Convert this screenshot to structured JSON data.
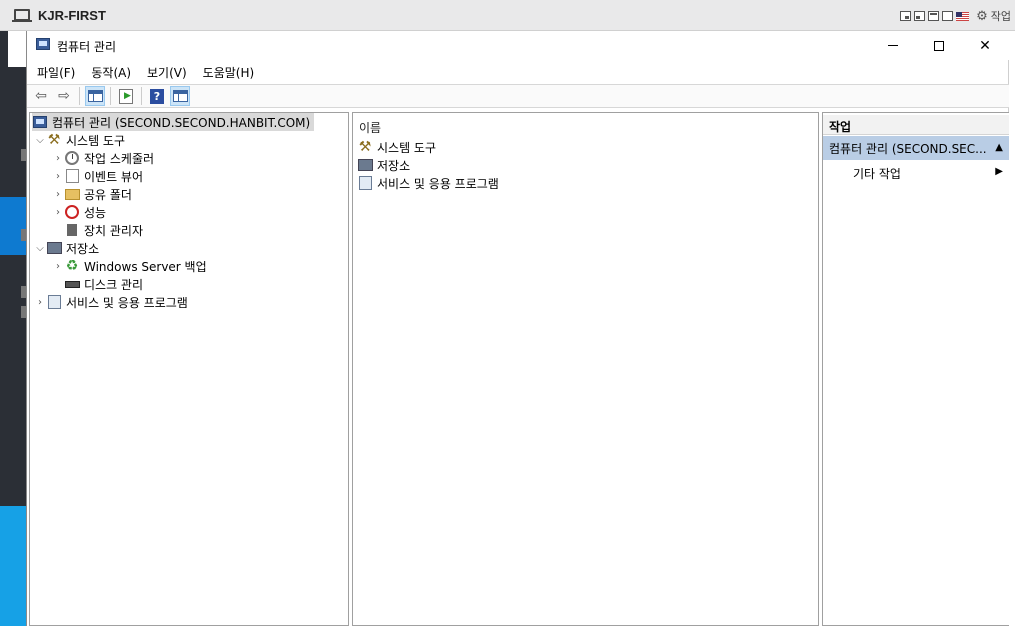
{
  "vm": {
    "title": "KJR-FIRST",
    "actions_label": "작업"
  },
  "window": {
    "title": "컴퓨터 관리",
    "minimize": "─",
    "maximize": "☐",
    "close": "✕"
  },
  "menu": [
    "파일(F)",
    "동작(A)",
    "보기(V)",
    "도움말(H)"
  ],
  "toolbar": {
    "back_icon": "back-arrow-icon",
    "forward_icon": "forward-arrow-icon",
    "help": "?"
  },
  "tree": {
    "root": "컴퓨터 관리 (SECOND.SECOND.HANBIT.COM)",
    "system_tools": "시스템 도구",
    "task_scheduler": "작업 스케줄러",
    "event_viewer": "이벤트 뷰어",
    "shared_folders": "공유 폴더",
    "performance": "성능",
    "device_manager": "장치 관리자",
    "storage": "저장소",
    "windows_server_backup": "Windows Server 백업",
    "disk_management": "디스크 관리",
    "services_apps": "서비스 및 응용 프로그램"
  },
  "list": {
    "header": "이름",
    "items": [
      "시스템 도구",
      "저장소",
      "서비스 및 응용 프로그램"
    ]
  },
  "actions": {
    "header": "작업",
    "section": "컴퓨터 관리 (SECOND.SEC...",
    "more": "기타 작업"
  },
  "colors": {
    "selection_bg": "#d9d9d9",
    "action_section_bg": "#b9cde5",
    "desktop_blue": "#16a1e6"
  }
}
